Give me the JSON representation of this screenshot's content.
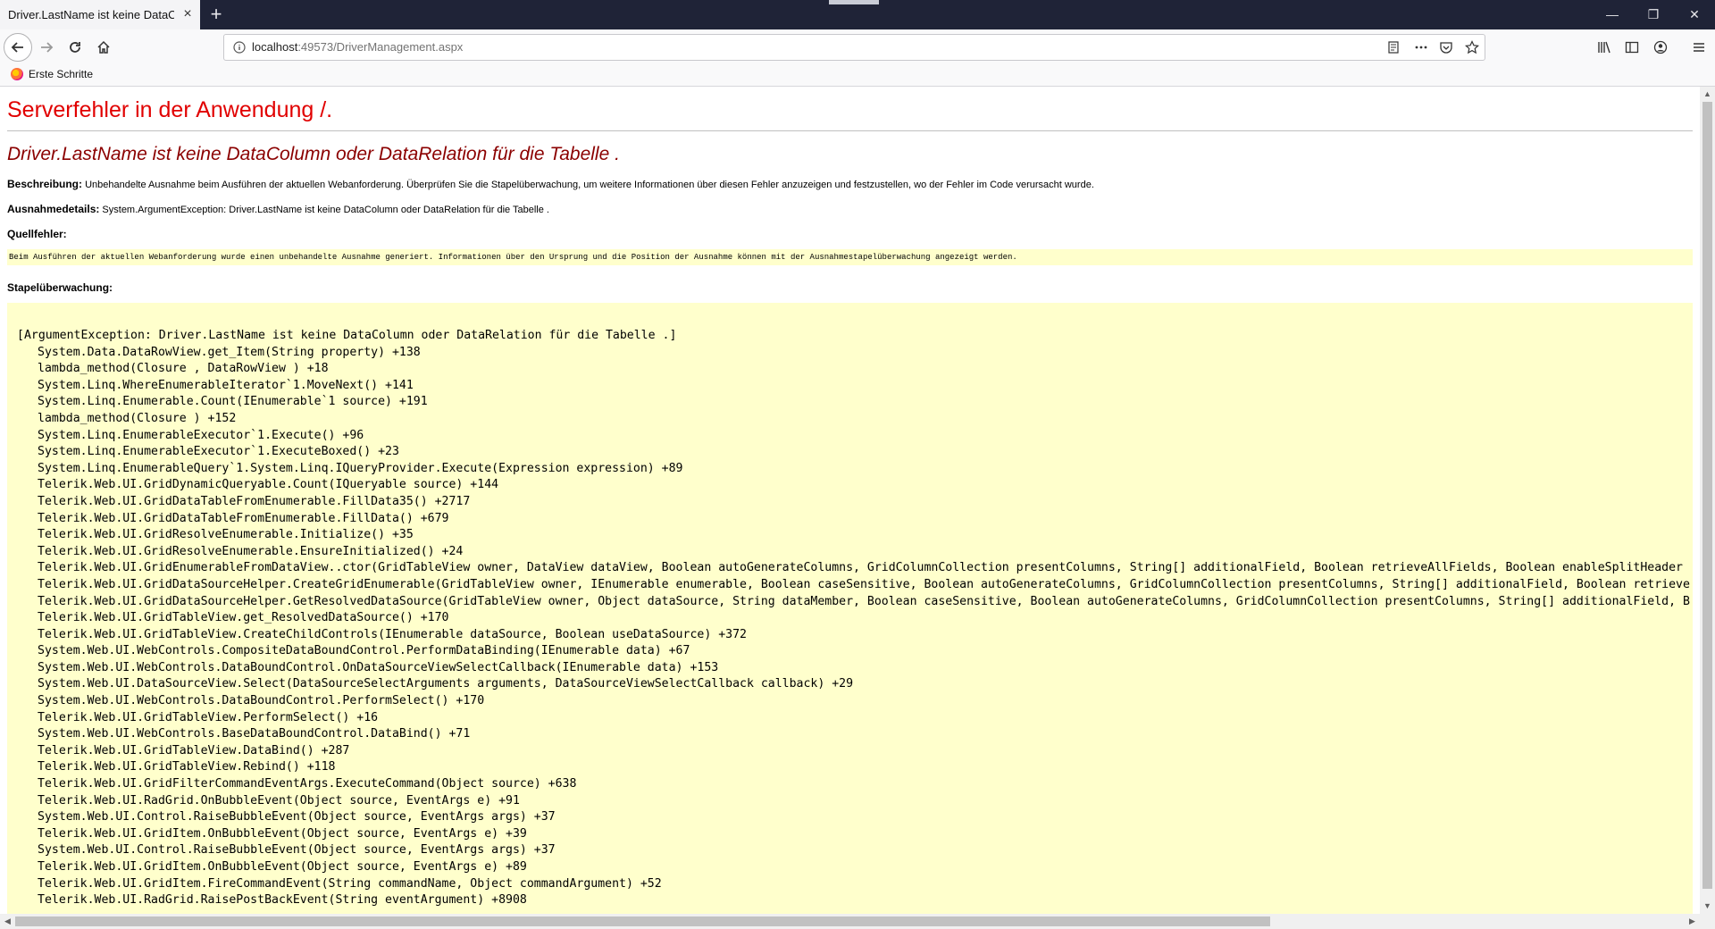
{
  "tab": {
    "title": "Driver.LastName ist keine DataColumn oder DataRelation für die Tabelle ."
  },
  "window": {
    "minimize": "—",
    "restore": "❐",
    "close": "✕"
  },
  "urlbar": {
    "host": "localhost",
    "rest": ":49573/DriverManagement.aspx"
  },
  "bookmarks": {
    "items": [
      {
        "label": "Erste Schritte"
      }
    ]
  },
  "page": {
    "server_error": "Serverfehler in der Anwendung /.",
    "error_title": "Driver.LastName ist keine DataColumn oder DataRelation für die Tabelle .",
    "description_label": "Beschreibung:",
    "description_text": "Unbehandelte Ausnahme beim Ausführen der aktuellen Webanforderung. Überprüfen Sie die Stapelüberwachung, um weitere Informationen über diesen Fehler anzuzeigen und festzustellen, wo der Fehler im Code verursacht wurde.",
    "exception_label": "Ausnahmedetails:",
    "exception_text": "System.ArgumentException: Driver.LastName ist keine DataColumn oder DataRelation für die Tabelle .",
    "source_label": "Quellfehler:",
    "source_text": "Beim Ausführen der aktuellen Webanforderung wurde einen unbehandelte Ausnahme generiert. Informationen über den Ursprung und die Position der Ausnahme können mit der Ausnahmestapelüberwachung angezeigt werden.",
    "stack_label": "Stapelüberwachung:",
    "stack": [
      "[ArgumentException: Driver.LastName ist keine DataColumn oder DataRelation für die Tabelle .]",
      "System.Data.DataRowView.get_Item(String property) +138",
      "lambda_method(Closure , DataRowView ) +18",
      "System.Linq.WhereEnumerableIterator`1.MoveNext() +141",
      "System.Linq.Enumerable.Count(IEnumerable`1 source) +191",
      "lambda_method(Closure ) +152",
      "System.Linq.EnumerableExecutor`1.Execute() +96",
      "System.Linq.EnumerableExecutor`1.ExecuteBoxed() +23",
      "System.Linq.EnumerableQuery`1.System.Linq.IQueryProvider.Execute(Expression expression) +89",
      "Telerik.Web.UI.GridDynamicQueryable.Count(IQueryable source) +144",
      "Telerik.Web.UI.GridDataTableFromEnumerable.FillData35() +2717",
      "Telerik.Web.UI.GridDataTableFromEnumerable.FillData() +679",
      "Telerik.Web.UI.GridResolveEnumerable.Initialize() +35",
      "Telerik.Web.UI.GridResolveEnumerable.EnsureInitialized() +24",
      "Telerik.Web.UI.GridEnumerableFromDataView..ctor(GridTableView owner, DataView dataView, Boolean autoGenerateColumns, GridColumnCollection presentColumns, String[] additionalField, Boolean retrieveAllFields, Boolean enableSplitHeader",
      "Telerik.Web.UI.GridDataSourceHelper.CreateGridEnumerable(GridTableView owner, IEnumerable enumerable, Boolean caseSensitive, Boolean autoGenerateColumns, GridColumnCollection presentColumns, String[] additionalField, Boolean retrieve",
      "Telerik.Web.UI.GridDataSourceHelper.GetResolvedDataSource(GridTableView owner, Object dataSource, String dataMember, Boolean caseSensitive, Boolean autoGenerateColumns, GridColumnCollection presentColumns, String[] additionalField, B",
      "Telerik.Web.UI.GridTableView.get_ResolvedDataSource() +170",
      "Telerik.Web.UI.GridTableView.CreateChildControls(IEnumerable dataSource, Boolean useDataSource) +372",
      "System.Web.UI.WebControls.CompositeDataBoundControl.PerformDataBinding(IEnumerable data) +67",
      "System.Web.UI.WebControls.DataBoundControl.OnDataSourceViewSelectCallback(IEnumerable data) +153",
      "System.Web.UI.DataSourceView.Select(DataSourceSelectArguments arguments, DataSourceViewSelectCallback callback) +29",
      "System.Web.UI.WebControls.DataBoundControl.PerformSelect() +170",
      "Telerik.Web.UI.GridTableView.PerformSelect() +16",
      "System.Web.UI.WebControls.BaseDataBoundControl.DataBind() +71",
      "Telerik.Web.UI.GridTableView.DataBind() +287",
      "Telerik.Web.UI.GridTableView.Rebind() +118",
      "Telerik.Web.UI.GridFilterCommandEventArgs.ExecuteCommand(Object source) +638",
      "Telerik.Web.UI.RadGrid.OnBubbleEvent(Object source, EventArgs e) +91",
      "System.Web.UI.Control.RaiseBubbleEvent(Object source, EventArgs args) +37",
      "Telerik.Web.UI.GridItem.OnBubbleEvent(Object source, EventArgs e) +39",
      "System.Web.UI.Control.RaiseBubbleEvent(Object source, EventArgs args) +37",
      "Telerik.Web.UI.GridItem.OnBubbleEvent(Object source, EventArgs e) +89",
      "Telerik.Web.UI.GridItem.FireCommandEvent(String commandName, Object commandArgument) +52",
      "Telerik.Web.UI.RadGrid.RaisePostBackEvent(String eventArgument) +8908"
    ]
  },
  "colors": {
    "server_error": "#e10000",
    "error_title": "#8b0000",
    "code_bg": "#ffffcc",
    "titlebar": "#1f2337"
  }
}
